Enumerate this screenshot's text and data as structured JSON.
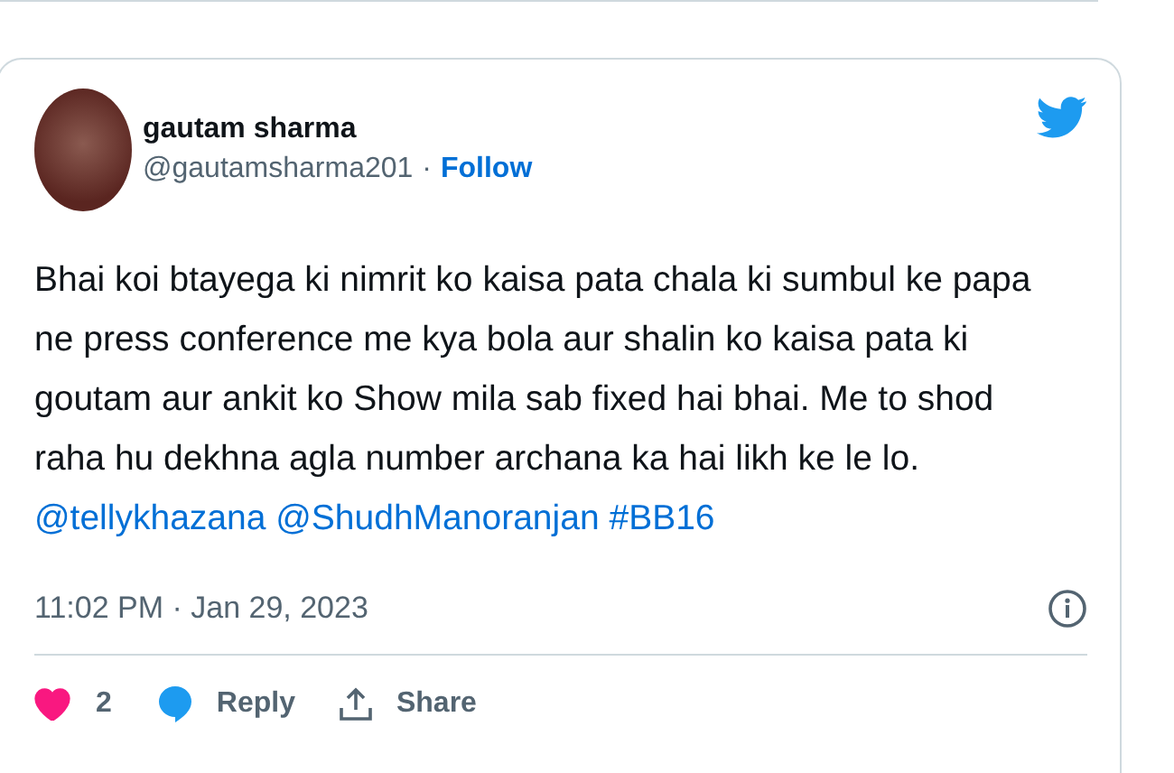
{
  "tweet": {
    "author": {
      "name": "gautam sharma",
      "handle": "@gautamsharma201",
      "separator": "·",
      "follow": "Follow"
    },
    "body": {
      "text": "Bhai koi btayega ki nimrit ko kaisa pata chala ki sumbul ke papa ne press conference me kya bola aur shalin ko kaisa pata ki goutam aur ankit ko Show mila sab fixed hai bhai. Me to shod raha hu dekhna agla number archana ka hai likh ke le lo.",
      "links": [
        "@tellykhazana",
        "@ShudhManoranjan",
        "#BB16"
      ]
    },
    "timestamp": "11:02 PM · Jan 29, 2023",
    "actions": {
      "liked": true,
      "like_count": "2",
      "reply": "Reply",
      "share": "Share"
    }
  }
}
